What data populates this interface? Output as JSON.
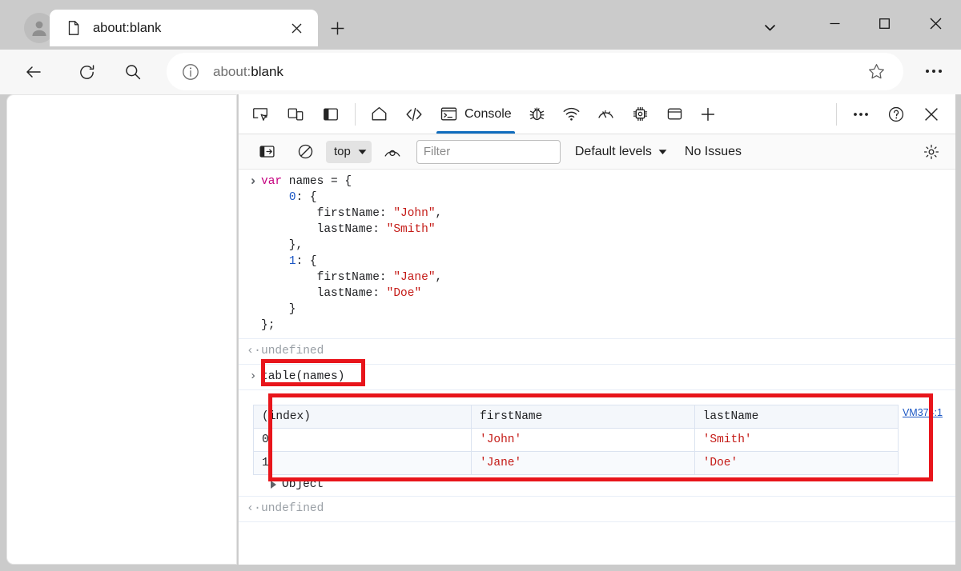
{
  "browser": {
    "profile_icon": "account-avatar",
    "tab": {
      "title": "about:blank",
      "favicon_icon": "page-icon",
      "close_icon": "close-icon"
    },
    "new_tab_label": "+",
    "tab_search_icon": "chevron-down-icon",
    "window_controls": {
      "minimize": "minimize-icon",
      "maximize": "maximize-icon",
      "close": "close-icon"
    },
    "nav": {
      "back_icon": "back-arrow-icon",
      "reload_icon": "reload-icon",
      "search_icon": "search-icon",
      "info_icon": "info-circle-icon",
      "star_icon": "star-icon",
      "more_icon": "ellipsis-icon"
    },
    "address": {
      "value": "about:blank",
      "scheme": "about:",
      "host": "blank"
    }
  },
  "devtools": {
    "left_tools": [
      {
        "name": "inspect-element-icon",
        "label": "Inspect"
      },
      {
        "name": "device-emulation-icon",
        "label": "Device Emulation"
      },
      {
        "name": "dock-side-icon",
        "label": "Dock side"
      }
    ],
    "tabs": [
      {
        "label": "",
        "icon": "home-icon",
        "active": false
      },
      {
        "label": "",
        "icon": "elements-icon",
        "active": false
      },
      {
        "label": "Console",
        "icon": "console-icon",
        "active": true
      },
      {
        "label": "",
        "icon": "debugger-icon",
        "active": false
      },
      {
        "label": "",
        "icon": "network-icon",
        "active": false
      },
      {
        "label": "",
        "icon": "performance-icon",
        "active": false
      },
      {
        "label": "",
        "icon": "memory-icon",
        "active": false
      },
      {
        "label": "",
        "icon": "application-icon",
        "active": false
      },
      {
        "label": "",
        "icon": "add-tab-icon",
        "active": false
      }
    ],
    "right_tools": [
      {
        "name": "more-tools-icon",
        "label": "More tools"
      },
      {
        "name": "help-icon",
        "label": "Help"
      },
      {
        "name": "close-devtools-icon",
        "label": "Close DevTools"
      }
    ],
    "filterbar": {
      "console_sidebar_icon": "console-sidebar-icon",
      "clear_console_icon": "clear-console-icon",
      "context_selector": {
        "value": "top",
        "caret_icon": "caret-down-icon"
      },
      "live_expression_icon": "eye-icon",
      "filter": {
        "value": "",
        "placeholder": "Filter"
      },
      "levels": {
        "label": "Default levels",
        "caret_icon": "caret-down-icon"
      },
      "issues": "No Issues",
      "settings_icon": "gear-icon"
    },
    "console": {
      "prompt_in_icon": "chevron-right-icon",
      "prompt_out_icon": "return-arrow-icon",
      "entries": [
        {
          "type": "input",
          "code_lines": [
            [
              {
                "t": "kw",
                "s": "var"
              },
              {
                "t": "plain",
                "s": " names = {"
              }
            ],
            [
              {
                "t": "plain",
                "s": "    "
              },
              {
                "t": "num",
                "s": "0"
              },
              {
                "t": "plain",
                "s": ": {"
              }
            ],
            [
              {
                "t": "plain",
                "s": "        firstName: "
              },
              {
                "t": "str",
                "s": "\"John\""
              },
              {
                "t": "plain",
                "s": ","
              }
            ],
            [
              {
                "t": "plain",
                "s": "        lastName: "
              },
              {
                "t": "str",
                "s": "\"Smith\""
              }
            ],
            [
              {
                "t": "plain",
                "s": "    },"
              }
            ],
            [
              {
                "t": "plain",
                "s": "    "
              },
              {
                "t": "num",
                "s": "1"
              },
              {
                "t": "plain",
                "s": ": {"
              }
            ],
            [
              {
                "t": "plain",
                "s": "        firstName: "
              },
              {
                "t": "str",
                "s": "\"Jane\""
              },
              {
                "t": "plain",
                "s": ","
              }
            ],
            [
              {
                "t": "plain",
                "s": "        lastName: "
              },
              {
                "t": "str",
                "s": "\"Doe\""
              }
            ],
            [
              {
                "t": "plain",
                "s": "    }"
              }
            ],
            [
              {
                "t": "plain",
                "s": "};"
              }
            ]
          ]
        },
        {
          "type": "output",
          "text": "undefined"
        },
        {
          "type": "input",
          "text": "table(names)",
          "highlighted": true
        },
        {
          "type": "table",
          "source_link": "VM374:1",
          "object_label": "Object"
        },
        {
          "type": "output",
          "text": "undefined"
        }
      ]
    },
    "table_data": {
      "columns": [
        "(index)",
        "firstName",
        "lastName"
      ],
      "rows": [
        {
          "index": "0",
          "firstName": "'John'",
          "lastName": "'Smith'"
        },
        {
          "index": "1",
          "firstName": "'Jane'",
          "lastName": "'Doe'"
        }
      ]
    }
  },
  "annotations": {
    "color": "#e8151b",
    "boxes": [
      {
        "name": "command-highlight",
        "target": "table(names)"
      },
      {
        "name": "table-output-highlight",
        "target": "console-table"
      }
    ]
  }
}
